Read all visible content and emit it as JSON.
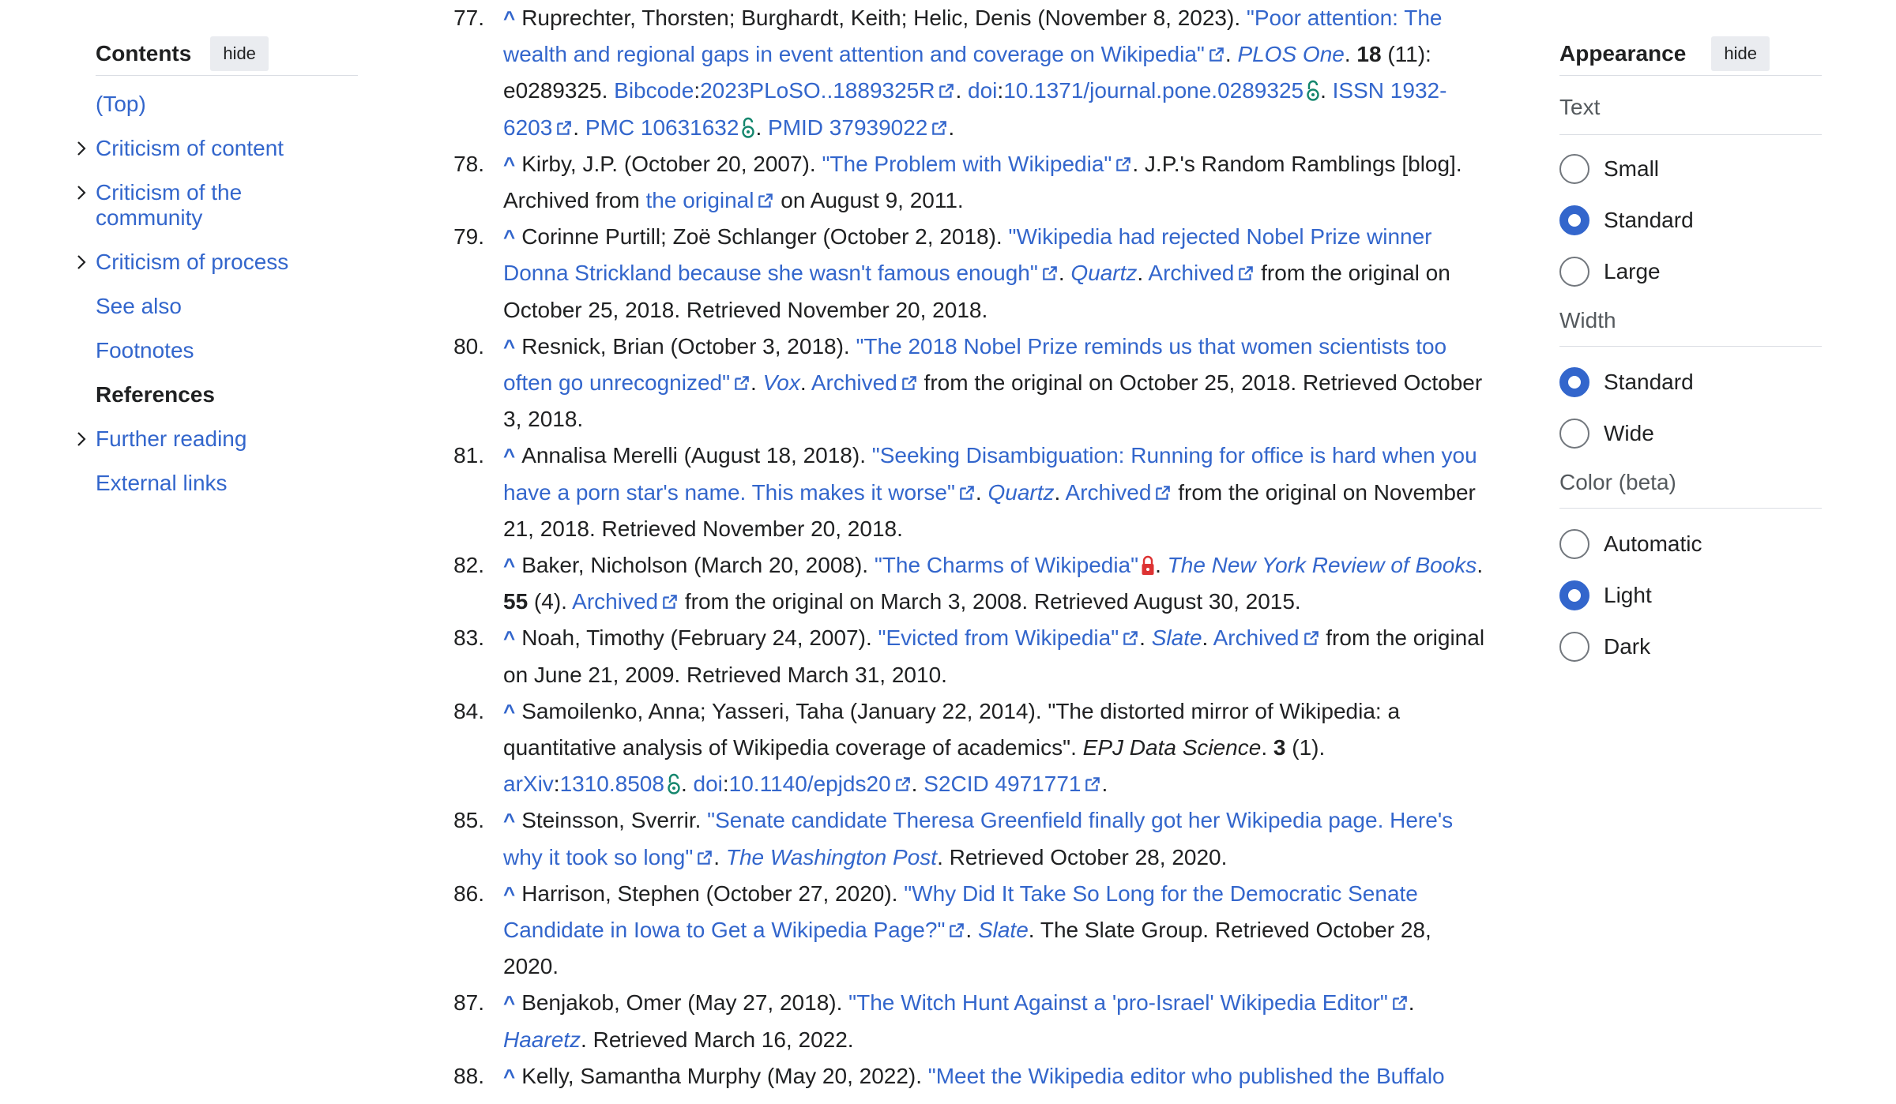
{
  "toc": {
    "title": "Contents",
    "hide_label": "hide",
    "items": [
      {
        "label": "(Top)",
        "expandable": false,
        "active": false
      },
      {
        "label": "Criticism of content",
        "expandable": true,
        "active": false
      },
      {
        "label": "Criticism of the community",
        "expandable": true,
        "active": false
      },
      {
        "label": "Criticism of process",
        "expandable": true,
        "active": false
      },
      {
        "label": "See also",
        "expandable": false,
        "active": false
      },
      {
        "label": "Footnotes",
        "expandable": false,
        "active": false
      },
      {
        "label": "References",
        "expandable": false,
        "active": true
      },
      {
        "label": "Further reading",
        "expandable": true,
        "active": false
      },
      {
        "label": "External links",
        "expandable": false,
        "active": false
      }
    ]
  },
  "appearance": {
    "title": "Appearance",
    "hide_label": "hide",
    "text_label": "Text",
    "text_options": [
      "Small",
      "Standard",
      "Large"
    ],
    "text_selected": "Standard",
    "width_label": "Width",
    "width_options": [
      "Standard",
      "Wide"
    ],
    "width_selected": "Standard",
    "color_label": "Color (beta)",
    "color_options": [
      "Automatic",
      "Light",
      "Dark"
    ],
    "color_selected": "Light"
  },
  "references": {
    "caret": "^",
    "items": [
      {
        "num": "77.",
        "segments": [
          {
            "t": "Ruprechter, Thorsten; Burghardt, Keith; Helic, Denis (November 8, 2023). "
          },
          {
            "t": "\"Poor attention: The wealth and regional gaps in event attention and coverage on Wikipedia\"",
            "link": true,
            "ext": true
          },
          {
            "t": ". "
          },
          {
            "t": "PLOS One",
            "link": true,
            "italic": true
          },
          {
            "t": ". "
          },
          {
            "t": "18",
            "bold": true
          },
          {
            "t": " (11): e0289325. "
          },
          {
            "t": "Bibcode",
            "link": true
          },
          {
            "t": ":"
          },
          {
            "t": "2023PLoSO..1889325R",
            "link": true,
            "ext": true
          },
          {
            "t": ". "
          },
          {
            "t": "doi",
            "link": true
          },
          {
            "t": ":"
          },
          {
            "t": "10.1371/journal.pone.0289325",
            "link": true,
            "lock": "open"
          },
          {
            "t": ". "
          },
          {
            "t": "ISSN",
            "link": true
          },
          {
            "t": " "
          },
          {
            "t": "1932-6203",
            "link": true,
            "ext": true
          },
          {
            "t": ". "
          },
          {
            "t": "PMC",
            "link": true
          },
          {
            "t": " "
          },
          {
            "t": "10631632",
            "link": true,
            "lock": "open"
          },
          {
            "t": ". "
          },
          {
            "t": "PMID",
            "link": true
          },
          {
            "t": " "
          },
          {
            "t": "37939022",
            "link": true,
            "ext": true
          },
          {
            "t": "."
          }
        ]
      },
      {
        "num": "78.",
        "segments": [
          {
            "t": "Kirby, J.P. (October 20, 2007). "
          },
          {
            "t": "\"The Problem with Wikipedia\"",
            "link": true,
            "ext": true
          },
          {
            "t": ". J.P.'s Random Ramblings [blog]. Archived from "
          },
          {
            "t": "the original",
            "link": true,
            "ext": true
          },
          {
            "t": " on August 9, 2011."
          }
        ]
      },
      {
        "num": "79.",
        "segments": [
          {
            "t": "Corinne Purtill; Zoë Schlanger (October 2, 2018). "
          },
          {
            "t": "\"Wikipedia had rejected Nobel Prize winner Donna Strickland because she wasn't famous enough\"",
            "link": true,
            "ext": true
          },
          {
            "t": ". "
          },
          {
            "t": "Quartz",
            "link": true,
            "italic": true
          },
          {
            "t": ". "
          },
          {
            "t": "Archived",
            "link": true,
            "ext": true
          },
          {
            "t": " from the original on October 25, 2018. Retrieved November 20, 2018."
          }
        ]
      },
      {
        "num": "80.",
        "segments": [
          {
            "t": "Resnick, Brian (October 3, 2018). "
          },
          {
            "t": "\"The 2018 Nobel Prize reminds us that women scientists too often go unrecognized\"",
            "link": true,
            "ext": true
          },
          {
            "t": ". "
          },
          {
            "t": "Vox",
            "link": true,
            "italic": true
          },
          {
            "t": ". "
          },
          {
            "t": "Archived",
            "link": true,
            "ext": true
          },
          {
            "t": " from the original on October 25, 2018. Retrieved October 3, 2018."
          }
        ]
      },
      {
        "num": "81.",
        "segments": [
          {
            "t": "Annalisa Merelli (August 18, 2018). "
          },
          {
            "t": "\"Seeking Disambiguation: Running for office is hard when you have a porn star's name. This makes it worse\"",
            "link": true,
            "ext": true
          },
          {
            "t": ". "
          },
          {
            "t": "Quartz",
            "link": true,
            "italic": true
          },
          {
            "t": ". "
          },
          {
            "t": "Archived",
            "link": true,
            "ext": true
          },
          {
            "t": " from the original on November 21, 2018. Retrieved November 20, 2018."
          }
        ]
      },
      {
        "num": "82.",
        "segments": [
          {
            "t": "Baker, Nicholson (March 20, 2008). "
          },
          {
            "t": "\"The Charms of Wikipedia\"",
            "link": true,
            "lock": "closed"
          },
          {
            "t": ". "
          },
          {
            "t": "The New York Review of Books",
            "link": true,
            "italic": true
          },
          {
            "t": ". "
          },
          {
            "t": "55",
            "bold": true
          },
          {
            "t": " (4). "
          },
          {
            "t": "Archived",
            "link": true,
            "ext": true
          },
          {
            "t": " from the original on March 3, 2008. Retrieved August 30, 2015."
          }
        ]
      },
      {
        "num": "83.",
        "segments": [
          {
            "t": "Noah, Timothy (February 24, 2007). "
          },
          {
            "t": "\"Evicted from Wikipedia\"",
            "link": true,
            "ext": true
          },
          {
            "t": ". "
          },
          {
            "t": "Slate",
            "link": true,
            "italic": true
          },
          {
            "t": ". "
          },
          {
            "t": "Archived",
            "link": true,
            "ext": true
          },
          {
            "t": " from the original on June 21, 2009. Retrieved March 31, 2010."
          }
        ]
      },
      {
        "num": "84.",
        "segments": [
          {
            "t": "Samoilenko, Anna; Yasseri, Taha (January 22, 2014). \"The distorted mirror of Wikipedia: a quantitative analysis of Wikipedia coverage of academics\". "
          },
          {
            "t": "EPJ Data Science",
            "italic": true
          },
          {
            "t": ". "
          },
          {
            "t": "3",
            "bold": true
          },
          {
            "t": " (1). "
          },
          {
            "t": "arXiv",
            "link": true
          },
          {
            "t": ":"
          },
          {
            "t": "1310.8508",
            "link": true,
            "lock": "open"
          },
          {
            "t": ". "
          },
          {
            "t": "doi",
            "link": true
          },
          {
            "t": ":"
          },
          {
            "t": "10.1140/epjds20",
            "link": true,
            "ext": true
          },
          {
            "t": ". "
          },
          {
            "t": "S2CID",
            "link": true
          },
          {
            "t": " "
          },
          {
            "t": "4971771",
            "link": true,
            "ext": true
          },
          {
            "t": "."
          }
        ]
      },
      {
        "num": "85.",
        "segments": [
          {
            "t": "Steinsson, Sverrir. "
          },
          {
            "t": "\"Senate candidate Theresa Greenfield finally got her Wikipedia page. Here's why it took so long\"",
            "link": true,
            "ext": true
          },
          {
            "t": ". "
          },
          {
            "t": "The Washington Post",
            "link": true,
            "italic": true
          },
          {
            "t": ". Retrieved October 28, 2020."
          }
        ]
      },
      {
        "num": "86.",
        "segments": [
          {
            "t": "Harrison, Stephen (October 27, 2020). "
          },
          {
            "t": "\"Why Did It Take So Long for the Democratic Senate Candidate in Iowa to Get a Wikipedia Page?\"",
            "link": true,
            "ext": true
          },
          {
            "t": ". "
          },
          {
            "t": "Slate",
            "link": true,
            "italic": true
          },
          {
            "t": ". The Slate Group. Retrieved October 28, 2020."
          }
        ]
      },
      {
        "num": "87.",
        "segments": [
          {
            "t": "Benjakob, Omer (May 27, 2018). "
          },
          {
            "t": "\"The Witch Hunt Against a 'pro-Israel' Wikipedia Editor\"",
            "link": true,
            "ext": true
          },
          {
            "t": ". "
          },
          {
            "t": "Haaretz",
            "link": true,
            "italic": true
          },
          {
            "t": ". Retrieved March 16, 2022."
          }
        ]
      },
      {
        "num": "88.",
        "segments": [
          {
            "t": "Kelly, Samantha Murphy (May 20, 2022). "
          },
          {
            "t": "\"Meet the Wikipedia editor who published the Buffalo",
            "link": true
          }
        ]
      }
    ]
  },
  "colors": {
    "link": "#3366cc",
    "text": "#202122",
    "open_access": "#14866d",
    "locked": "#d33",
    "muted": "#54595d"
  }
}
